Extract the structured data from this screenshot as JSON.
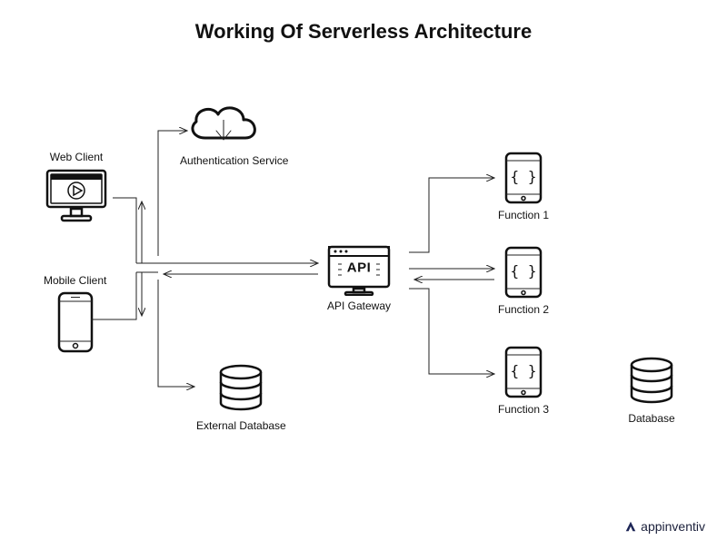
{
  "title": "Working Of Serverless Architecture",
  "nodes": {
    "web_client": "Web Client",
    "mobile_client": "Mobile Client",
    "auth_service": "Authentication Service",
    "external_db": "External Database",
    "api_gateway": "API Gateway",
    "api_badge": "API",
    "function1": "Function 1",
    "function2": "Function 2",
    "function3": "Function 3",
    "database": "Database"
  },
  "brand": "appinventiv"
}
